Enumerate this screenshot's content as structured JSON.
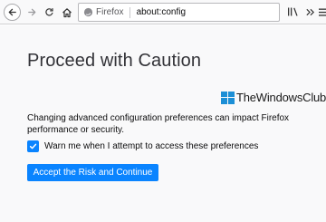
{
  "toolbar": {
    "back_icon": "back-arrow-icon",
    "forward_icon": "forward-arrow-icon",
    "reload_icon": "reload-icon",
    "home_icon": "home-icon",
    "identity_label": "Firefox",
    "url": "about:config",
    "library_icon": "library-icon",
    "overflow_icon": "overflow-chevrons-icon",
    "menu_icon": "menu-icon"
  },
  "watermark": {
    "text": "TheWindowsClub",
    "color": "#1c8fd6"
  },
  "page": {
    "title": "Proceed with Caution",
    "description": "Changing advanced configuration preferences can impact Firefox performance or security.",
    "warn_checkbox": {
      "label": "Warn me when I attempt to access these preferences",
      "checked": true
    },
    "accept_button": "Accept the Risk and Continue"
  },
  "colors": {
    "accent": "#0a84ff",
    "page_background": "#f9f9fa",
    "title_text": "#333338"
  }
}
